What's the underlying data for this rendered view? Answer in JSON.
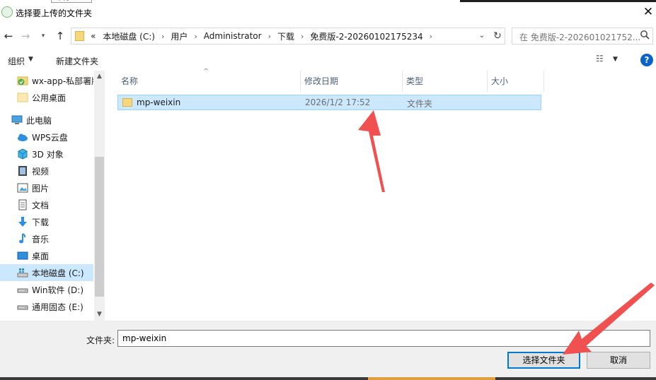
{
  "window": {
    "title": "选择要上传的文件夹",
    "close_glyph": "✕",
    "background_tab_label": "大小"
  },
  "nav": {
    "back_glyph": "←",
    "forward_glyph": "→",
    "recent_glyph": "▾",
    "up_glyph": "↑"
  },
  "address": {
    "overflow": "«",
    "crumbs": [
      "本地磁盘 (C:)",
      "用户",
      "Administrator",
      "下载",
      "免费版-2-20260102175234"
    ],
    "separator": "›",
    "dropdown_glyph": "⌄",
    "refresh_glyph": "↻"
  },
  "search": {
    "placeholder": "在 免费版-2-202601021752...",
    "icon": "search-icon"
  },
  "toolbar": {
    "organize": "组织",
    "organize_caret": "▼",
    "new_folder": "新建文件夹",
    "view_glyph": "☷",
    "view_caret": "▼",
    "help": "?"
  },
  "sidebar": {
    "scroll_up": "▲",
    "scroll_down": "▼",
    "items": [
      {
        "label": "wx-app-私部署版",
        "icon": "check-folder-icon"
      },
      {
        "label": "公用桌面",
        "icon": "folder-icon"
      },
      {
        "label": "此电脑",
        "icon": "computer-icon"
      },
      {
        "label": "WPS云盘",
        "icon": "cloud-icon"
      },
      {
        "label": "3D 对象",
        "icon": "cube-icon"
      },
      {
        "label": "视频",
        "icon": "video-icon"
      },
      {
        "label": "图片",
        "icon": "picture-icon"
      },
      {
        "label": "文档",
        "icon": "document-icon"
      },
      {
        "label": "下载",
        "icon": "download-icon"
      },
      {
        "label": "音乐",
        "icon": "music-icon"
      },
      {
        "label": "桌面",
        "icon": "desktop-icon"
      },
      {
        "label": "本地磁盘 (C:)",
        "icon": "drive-c-icon",
        "selected": true
      },
      {
        "label": "Win软件 (D:)",
        "icon": "drive-icon"
      },
      {
        "label": "通用固态 (E:)",
        "icon": "drive-icon"
      }
    ]
  },
  "file_list": {
    "sort_glyph": "^",
    "columns": {
      "name": "名称",
      "date": "修改日期",
      "type": "类型",
      "size": "大小"
    },
    "rows": [
      {
        "name": "mp-weixin",
        "date": "2026/1/2 17:52",
        "type": "文件夹",
        "size": "",
        "selected": true
      }
    ]
  },
  "footer": {
    "folder_label": "文件夹:",
    "folder_value": "mp-weixin",
    "select_button": "选择文件夹",
    "cancel_button": "取消"
  },
  "colors": {
    "selection": "#cce8ff",
    "selection_border": "#99d1ff",
    "annotation_arrow": "#f05050",
    "primary_button_border": "#0078d7",
    "folder_yellow": "#f6d77c"
  }
}
